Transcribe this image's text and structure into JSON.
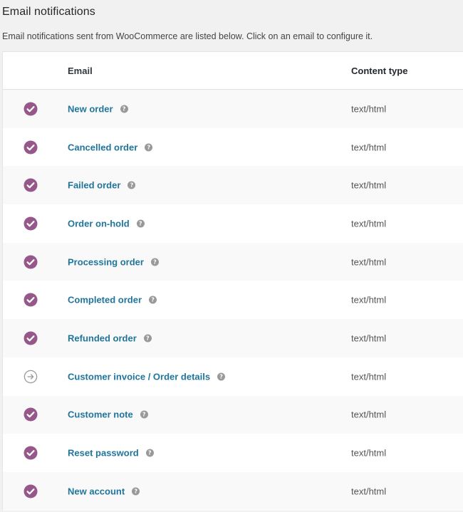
{
  "page": {
    "title": "Email notifications",
    "description": "Email notifications sent from WooCommerce are listed below. Click on an email to configure it."
  },
  "table": {
    "headers": {
      "email": "Email",
      "content_type": "Content type"
    },
    "rows": [
      {
        "name": "New order",
        "content_type": "text/html",
        "status": "enabled",
        "help": "?"
      },
      {
        "name": "Cancelled order",
        "content_type": "text/html",
        "status": "enabled",
        "help": "?"
      },
      {
        "name": "Failed order",
        "content_type": "text/html",
        "status": "enabled",
        "help": "?"
      },
      {
        "name": "Order on-hold",
        "content_type": "text/html",
        "status": "enabled",
        "help": "?"
      },
      {
        "name": "Processing order",
        "content_type": "text/html",
        "status": "enabled",
        "help": "?"
      },
      {
        "name": "Completed order",
        "content_type": "text/html",
        "status": "enabled",
        "help": "?"
      },
      {
        "name": "Refunded order",
        "content_type": "text/html",
        "status": "enabled",
        "help": "?"
      },
      {
        "name": "Customer invoice / Order details",
        "content_type": "text/html",
        "status": "manual",
        "help": "?"
      },
      {
        "name": "Customer note",
        "content_type": "text/html",
        "status": "enabled",
        "help": "?"
      },
      {
        "name": "Reset password",
        "content_type": "text/html",
        "status": "enabled",
        "help": "?"
      },
      {
        "name": "New account",
        "content_type": "text/html",
        "status": "enabled",
        "help": "?"
      }
    ]
  },
  "icons": {
    "enabled": "check-circle-icon",
    "manual": "arrow-right-circle-icon",
    "help": "help-icon"
  },
  "colors": {
    "enabled": "#96588a",
    "manual": "#999999",
    "link": "#21759b"
  }
}
